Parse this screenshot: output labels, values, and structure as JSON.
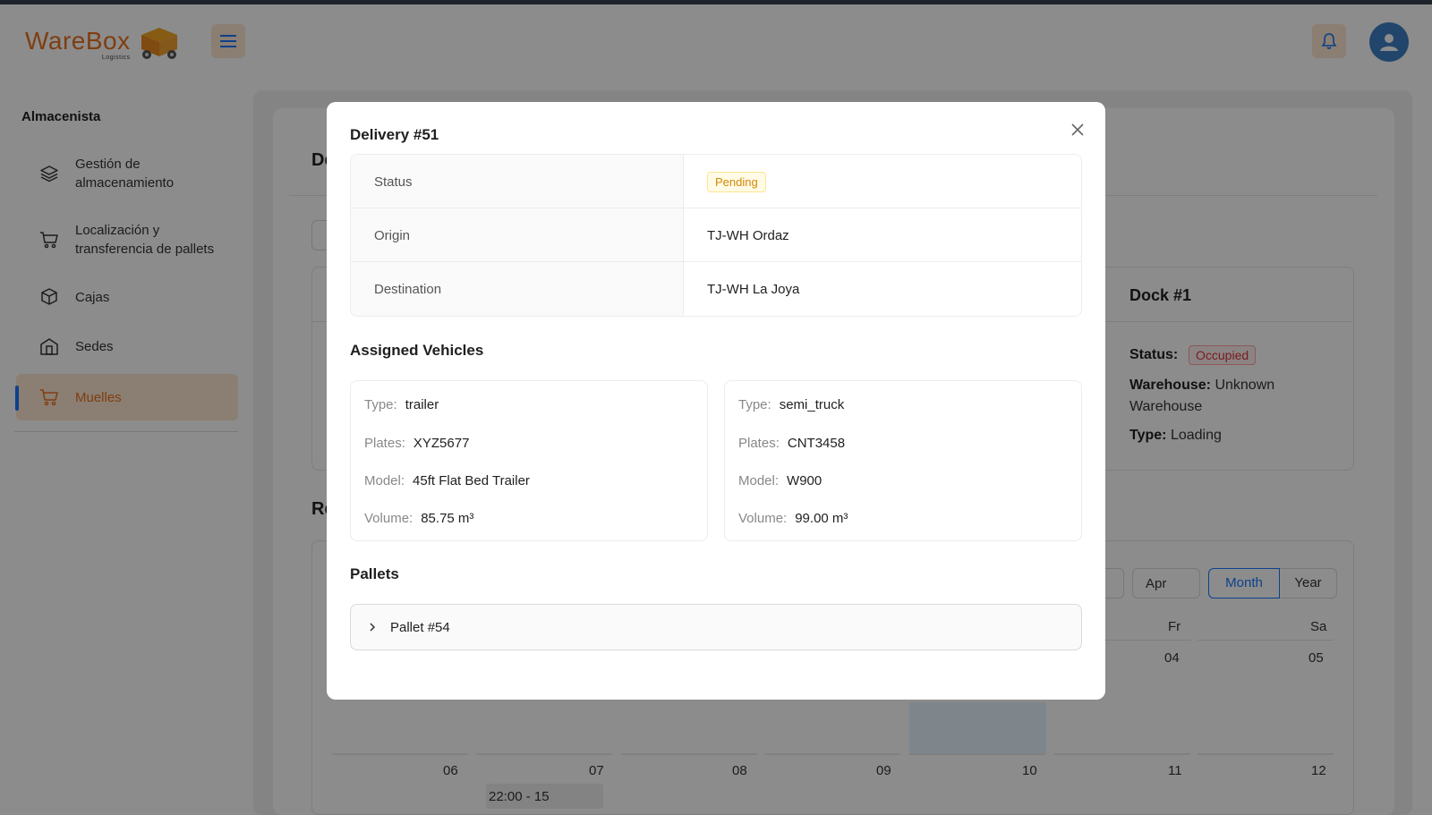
{
  "colors": {
    "accent": "#e8711f",
    "primary": "#1677ff",
    "avatar": "#3d7fc4"
  },
  "header": {
    "logo_text": "WareBox",
    "logo_sub": "Logistics",
    "menu_icon": "hamburger-icon",
    "bell_icon": "bell-icon",
    "avatar_icon": "user-icon"
  },
  "sidebar": {
    "title": "Almacenista",
    "items": [
      {
        "label": "Gestión de almacenamiento",
        "icon": "layers-icon"
      },
      {
        "label": "Localización y transferencia de pallets",
        "icon": "cart-icon"
      },
      {
        "label": "Cajas",
        "icon": "box-icon"
      },
      {
        "label": "Sedes",
        "icon": "building-icon"
      },
      {
        "label": "Muelles",
        "icon": "cart-icon",
        "active": true
      }
    ]
  },
  "background": {
    "section_title_partial": "De",
    "dock": {
      "title": "Dock #1",
      "status_label": "Status:",
      "status_value": "Occupied",
      "warehouse_label": "Warehouse:",
      "warehouse_value": "Unknown Warehouse",
      "type_label": "Type:",
      "type_value": "Loading"
    },
    "reservations_title_partial": "Re",
    "calendar": {
      "month_select": "Apr",
      "mode_month": "Month",
      "mode_year": "Year",
      "day_headers": [
        "Fr",
        "Sa"
      ],
      "week1": [
        "04",
        "05"
      ],
      "week2": [
        "06",
        "07",
        "08",
        "09",
        "10",
        "11",
        "12"
      ],
      "event": "22:00 - 15"
    }
  },
  "modal": {
    "title": "Delivery #51",
    "rows": [
      {
        "label": "Status",
        "value": "Pending"
      },
      {
        "label": "Origin",
        "value": "TJ-WH Ordaz"
      },
      {
        "label": "Destination",
        "value": "TJ-WH La Joya"
      }
    ],
    "vehicles_title": "Assigned Vehicles",
    "vehicles": [
      {
        "type_k": "Type",
        "type": "trailer",
        "plates_k": "Plates",
        "plates": "XYZ5677",
        "model_k": "Model",
        "model": "45ft Flat Bed Trailer",
        "volume_k": "Volume",
        "volume": "85.75 m³"
      },
      {
        "type_k": "Type",
        "type": "semi_truck",
        "plates_k": "Plates",
        "plates": "CNT3458",
        "model_k": "Model",
        "model": "W900",
        "volume_k": "Volume",
        "volume": "99.00 m³"
      }
    ],
    "pallets_title": "Pallets",
    "pallets": [
      {
        "label": "Pallet #54"
      }
    ]
  }
}
